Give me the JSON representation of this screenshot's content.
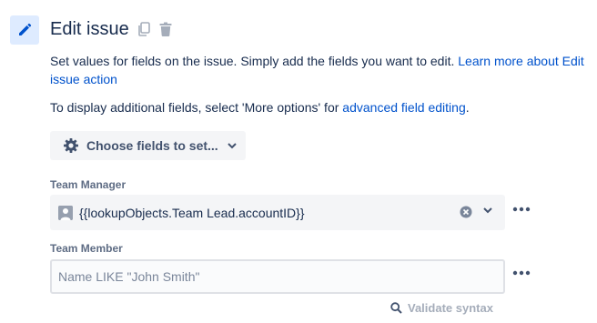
{
  "header": {
    "title": "Edit issue",
    "icons": [
      "pencil-icon",
      "copy-icon",
      "trash-icon"
    ]
  },
  "description": {
    "text": "Set values for fields on the issue. Simply add the fields you want to edit. ",
    "link": "Learn more about Edit issue action"
  },
  "display_note": {
    "text": "To display additional fields, select 'More options' for ",
    "link": "advanced field editing",
    "suffix": "."
  },
  "choose_fields": {
    "label": "Choose fields to set..."
  },
  "fields": {
    "team_manager": {
      "label": "Team Manager",
      "value": "{{lookupObjects.Team Lead.accountID}}"
    },
    "team_member": {
      "label": "Team Member",
      "value": "",
      "placeholder": "Name LIKE \"John Smith\""
    }
  },
  "validate": {
    "label": "Validate syntax"
  },
  "colors": {
    "accent": "#0052cc",
    "icon_bg": "#deebff",
    "field_bg": "#f4f5f7"
  }
}
